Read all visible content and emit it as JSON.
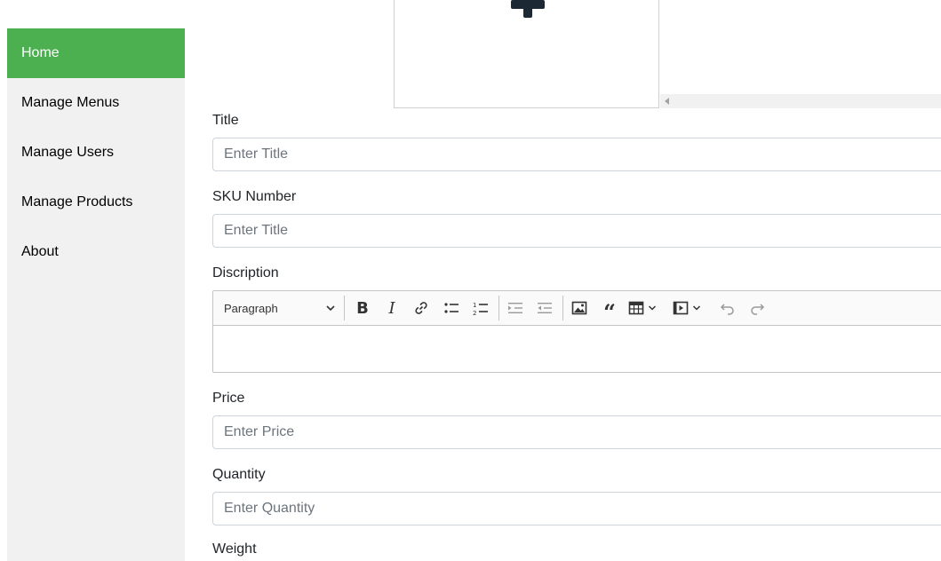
{
  "sidebar": {
    "items": [
      {
        "label": "Home",
        "active": true
      },
      {
        "label": "Manage Menus"
      },
      {
        "label": "Manage Users"
      },
      {
        "label": "Manage Products"
      },
      {
        "label": "About"
      }
    ]
  },
  "upload": {
    "icon": "plus-icon"
  },
  "form": {
    "title": {
      "label": "Title",
      "placeholder": "Enter Title",
      "value": ""
    },
    "sku": {
      "label": "SKU Number",
      "placeholder": "Enter Title",
      "value": ""
    },
    "description": {
      "label": "Discription",
      "toolbar": {
        "heading_select": "Paragraph",
        "buttons": [
          "bold-icon",
          "italic-icon",
          "link-icon",
          "bulleted-list-icon",
          "numbered-list-icon",
          "outdent-icon",
          "indent-icon",
          "image-icon",
          "blockquote-icon",
          "table-icon",
          "media-icon",
          "undo-icon",
          "redo-icon"
        ]
      },
      "value": ""
    },
    "price": {
      "label": "Price",
      "placeholder": "Enter Price",
      "value": ""
    },
    "quantity": {
      "label": "Quantity",
      "placeholder": "Enter Quantity",
      "value": ""
    },
    "weight": {
      "label": "Weight"
    }
  },
  "colors": {
    "accent": "#4caf50",
    "sidebar_bg": "#f1f1f1"
  }
}
